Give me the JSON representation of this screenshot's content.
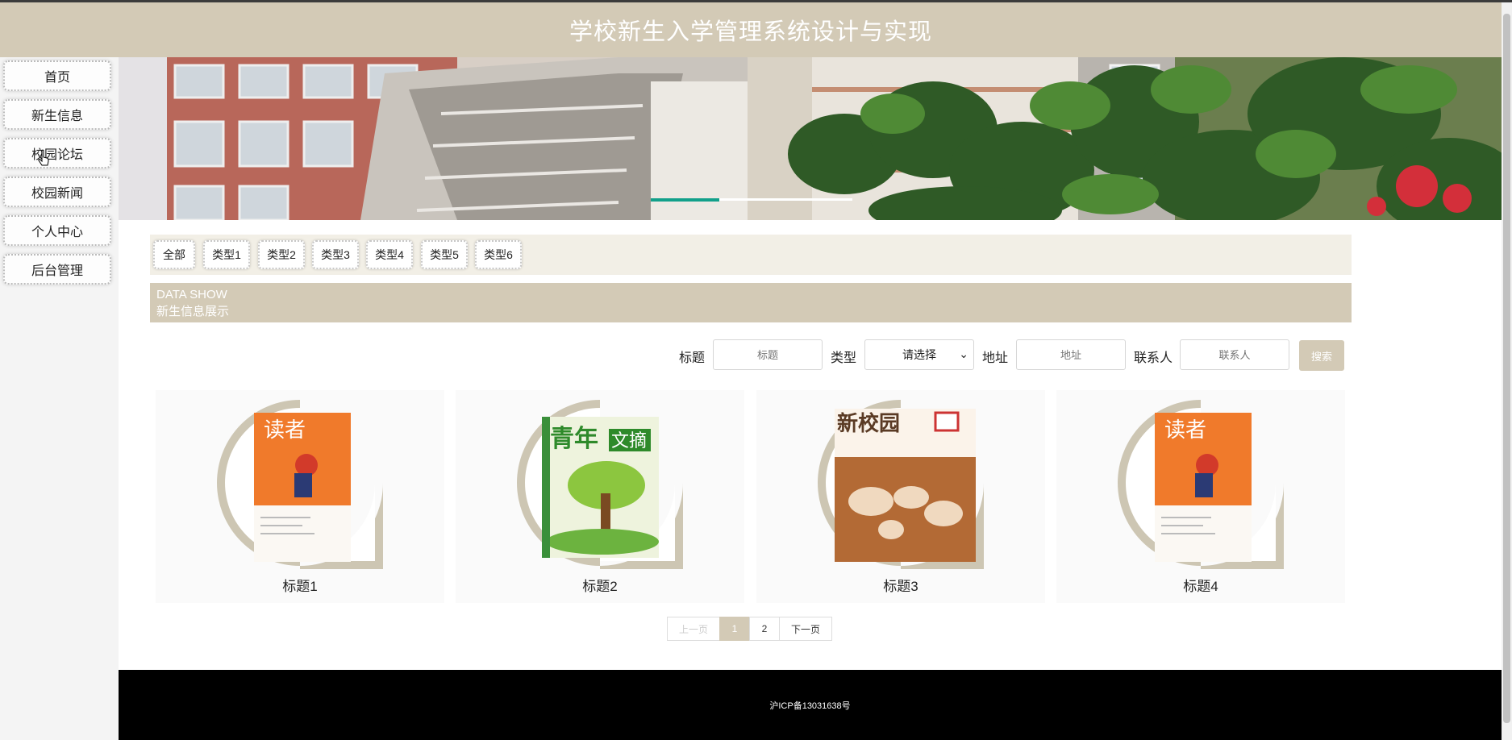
{
  "header": {
    "title": "学校新生入学管理系统设计与实现"
  },
  "nav": {
    "items": [
      {
        "label": "首页"
      },
      {
        "label": "新生信息"
      },
      {
        "label": "校园论坛"
      },
      {
        "label": "校园新闻"
      },
      {
        "label": "个人中心"
      },
      {
        "label": "后台管理"
      }
    ]
  },
  "filters": [
    "全部",
    "类型1",
    "类型2",
    "类型3",
    "类型4",
    "类型5",
    "类型6"
  ],
  "section": {
    "en": "DATA SHOW",
    "zh": "新生信息展示"
  },
  "search": {
    "title_label": "标题",
    "title_placeholder": "标题",
    "type_label": "类型",
    "type_selected": "请选择",
    "address_label": "地址",
    "address_placeholder": "地址",
    "contact_label": "联系人",
    "contact_placeholder": "联系人",
    "button": "搜索"
  },
  "cards": [
    {
      "title": "标题1",
      "image": "reader-magazine-cover"
    },
    {
      "title": "标题2",
      "image": "youth-digest-cover"
    },
    {
      "title": "标题3",
      "image": "new-campus-cover"
    },
    {
      "title": "标题4",
      "image": "reader-magazine-cover"
    }
  ],
  "pagination": {
    "prev": "上一页",
    "pages": [
      "1",
      "2"
    ],
    "current": "1",
    "next": "下一页"
  },
  "footer": {
    "icp": "沪ICP备13031638号"
  },
  "colors": {
    "accent": "#d3cab6",
    "footer": "#000000"
  }
}
